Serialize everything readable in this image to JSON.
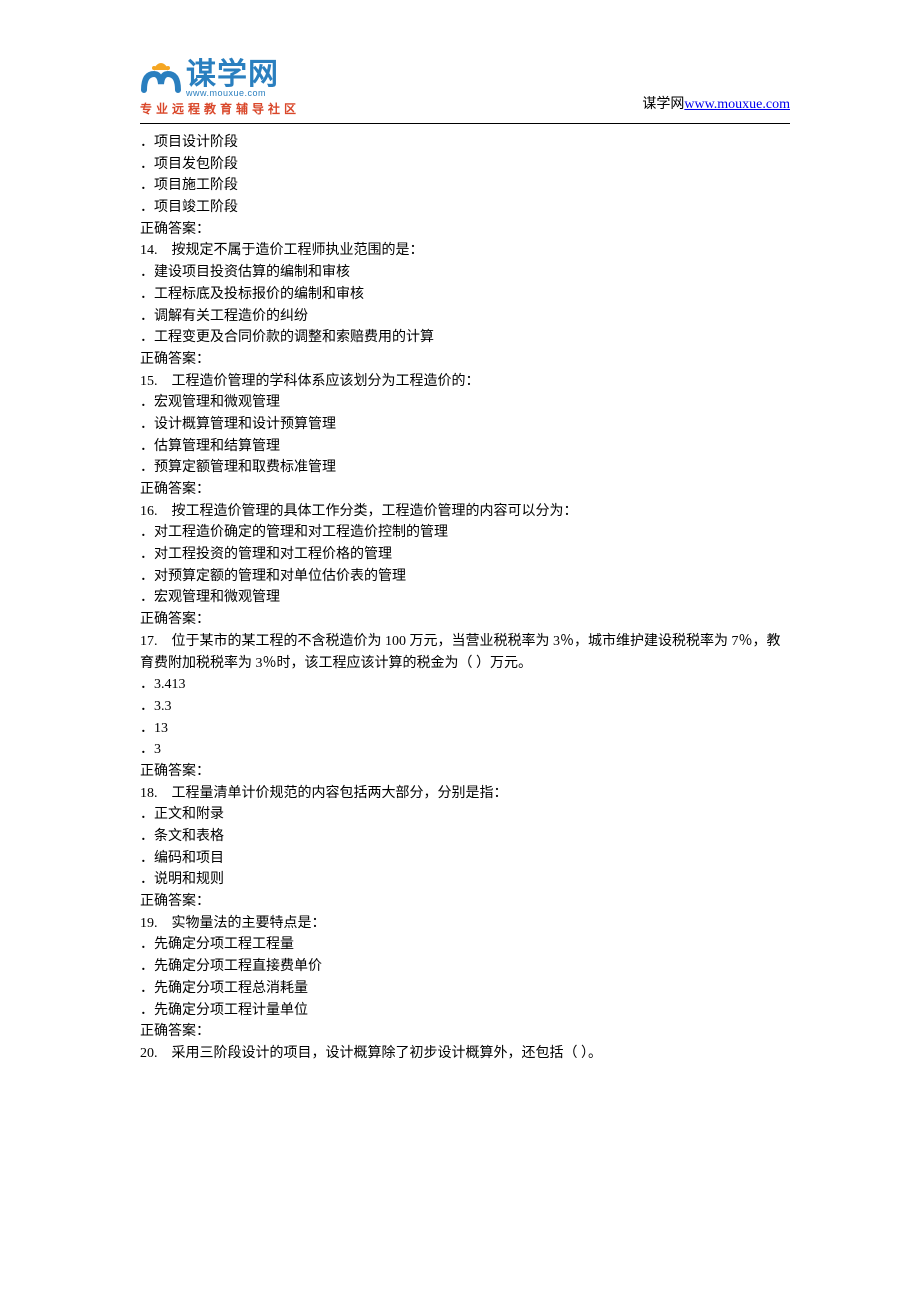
{
  "header": {
    "logo_cn": "谋学网",
    "logo_en": "www.mouxue.com",
    "tagline": "专业远程教育辅导社区",
    "source_label": "谋学网",
    "source_url": "www.mouxue.com"
  },
  "lines": [
    "．项目设计阶段",
    "．项目发包阶段",
    "．项目施工阶段",
    "．项目竣工阶段",
    "正确答案：",
    "14.　按规定不属于造价工程师执业范围的是：",
    "．建设项目投资估算的编制和审核",
    "．工程标底及投标报价的编制和审核",
    "．调解有关工程造价的纠纷",
    "．工程变更及合同价款的调整和索赔费用的计算",
    "正确答案：",
    "15.　工程造价管理的学科体系应该划分为工程造价的：",
    "．宏观管理和微观管理",
    "．设计概算管理和设计预算管理",
    "．估算管理和结算管理",
    "．预算定额管理和取费标准管理",
    "正确答案：",
    "16.　按工程造价管理的具体工作分类，工程造价管理的内容可以分为：",
    "．对工程造价确定的管理和对工程造价控制的管理",
    "．对工程投资的管理和对工程价格的管理",
    "．对预算定额的管理和对单位估价表的管理",
    "．宏观管理和微观管理",
    "正确答案：",
    "17.　位于某市的某工程的不含税造价为 100 万元，当营业税税率为 3％，城市维护建设税税率为 7％，教育费附加税税率为 3％时，该工程应该计算的税金为（ ）万元。",
    "．3.413",
    "．3.3",
    "．13",
    "．3",
    "正确答案：",
    "18.　工程量清单计价规范的内容包括两大部分，分别是指：",
    "．正文和附录",
    "．条文和表格",
    "．编码和项目",
    "．说明和规则",
    "正确答案：",
    "19.　实物量法的主要特点是：",
    "．先确定分项工程工程量",
    "．先确定分项工程直接费单价",
    "．先确定分项工程总消耗量",
    "．先确定分项工程计量单位",
    "正确答案：",
    "20.　采用三阶段设计的项目，设计概算除了初步设计概算外，还包括（ ）。"
  ]
}
